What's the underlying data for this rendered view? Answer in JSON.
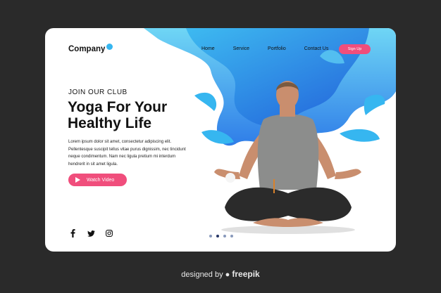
{
  "brand": {
    "name": "Company",
    "accent": "#36b6f0",
    "cta_color": "#f04e7c"
  },
  "nav": {
    "items": [
      "Home",
      "Service",
      "Portfolio",
      "Contact Us"
    ],
    "signup_label": "Sign Up"
  },
  "hero": {
    "kicker": "JOIN OUR CLUB",
    "headline": "Yoga For Your Healthy Life",
    "body": "Lorem ipsum dolor sit amet, consectetur adipiscing elit. Pellentesque suscipit tellus vitae purus dignissim, nec tincidunt neque condimentum. Nam nec ligula pretium mi interdum hendrerit in sit amet ligula.",
    "cta_label": "Watch Video"
  },
  "social": [
    "facebook-icon",
    "twitter-icon",
    "instagram-icon"
  ],
  "pagination": {
    "count": 4,
    "active": 1
  },
  "footer": {
    "credit_prefix": "designed by",
    "credit_brand": "freepik"
  }
}
